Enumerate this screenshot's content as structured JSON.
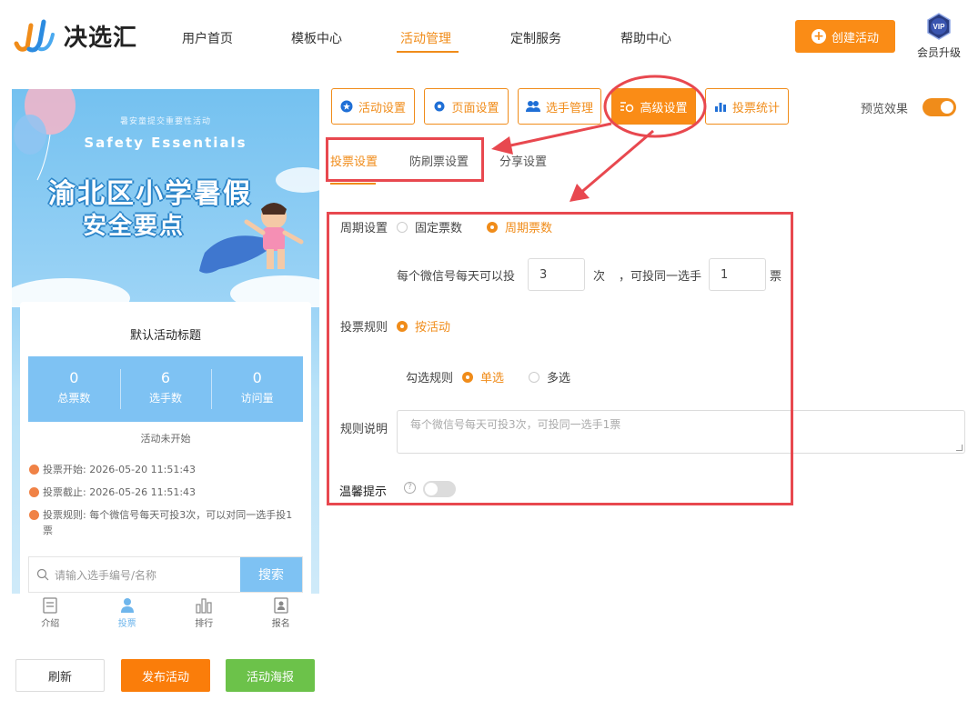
{
  "brand": {
    "name": "决选汇"
  },
  "nav": {
    "items": [
      {
        "label": "用户首页"
      },
      {
        "label": "模板中心"
      },
      {
        "label": "活动管理"
      },
      {
        "label": "定制服务"
      },
      {
        "label": "帮助中心"
      }
    ],
    "active": "活动管理",
    "create_label": "创建活动",
    "vip_badge": "VIP",
    "vip_label": "会员升级"
  },
  "preview": {
    "banner_sub": "暑安童提交重要性活动",
    "banner_en": "Safety  Essentials",
    "banner_title_1": "渝北区小学暑假",
    "banner_title_2": "安全要点",
    "card_title": "默认活动标题",
    "stats": [
      {
        "value": "0",
        "label": "总票数"
      },
      {
        "value": "6",
        "label": "选手数"
      },
      {
        "value": "0",
        "label": "访问量"
      }
    ],
    "status": "活动未开始",
    "vote_start": "投票开始:  2026-05-20 11:51:43",
    "vote_end": "投票截止:  2026-05-26 11:51:43",
    "vote_rule": "投票规则:  每个微信号每天可投3次，可以对同一选手投1票",
    "search_placeholder": "请输入选手编号/名称",
    "search_button": "搜索",
    "tabs": [
      {
        "label": "介绍",
        "icon": "doc-icon"
      },
      {
        "label": "投票",
        "icon": "user-icon"
      },
      {
        "label": "排行",
        "icon": "chart-icon"
      },
      {
        "label": "报名",
        "icon": "signup-icon"
      }
    ],
    "active_tab": "投票"
  },
  "actions": {
    "refresh": "刷新",
    "publish": "发布活动",
    "poster": "活动海报"
  },
  "settings_tabs": [
    {
      "label": "活动设置",
      "icon": "star-circle-icon"
    },
    {
      "label": "页面设置",
      "icon": "gear-icon"
    },
    {
      "label": "选手管理",
      "icon": "users-icon"
    },
    {
      "label": "高级设置",
      "icon": "advanced-gear-icon"
    },
    {
      "label": "投票统计",
      "icon": "bar-chart-icon"
    }
  ],
  "active_settings_tab": "高级设置",
  "preview_toggle": {
    "label": "预览效果",
    "on": true
  },
  "sub_tabs": [
    {
      "label": "投票设置"
    },
    {
      "label": "防刷票设置"
    },
    {
      "label": "分享设置"
    }
  ],
  "active_sub_tab": "投票设置",
  "form": {
    "cycle_label": "周期设置",
    "cycle_options": [
      "固定票数",
      "周期票数"
    ],
    "cycle_selected": "周期票数",
    "per_day_text": "每个微信号每天可以投",
    "per_day_value": "3",
    "times_unit": "次",
    "same_player_text": "，可投同一选手",
    "same_player_value": "1",
    "votes_unit": "票",
    "rule_label": "投票规则",
    "rule_option": "按活动",
    "check_rule_label": "勾选规则",
    "check_options": [
      "单选",
      "多选"
    ],
    "check_selected": "单选",
    "desc_label": "规则说明",
    "desc_placeholder": "每个微信号每天可投3次，可投同一选手1票",
    "tip_label": "温馨提示",
    "tip_help": "?",
    "tip_on": false
  },
  "colors": {
    "accent": "#fa8c16",
    "annotation": "#e8484f",
    "preview_blue": "#7ec2f3",
    "poster_green": "#6cc24a"
  }
}
